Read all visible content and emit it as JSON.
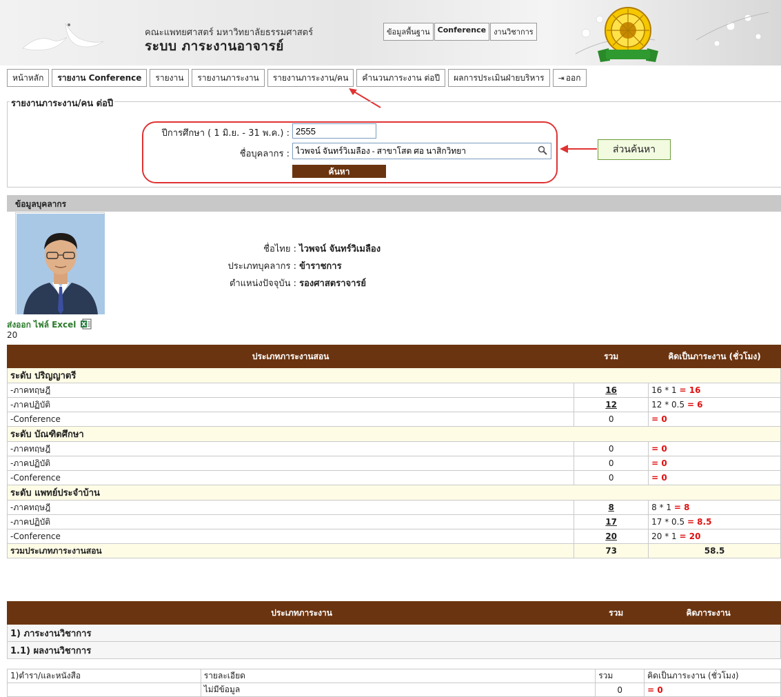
{
  "header": {
    "org_name": "คณะแพทยศาสตร์ มหาวิทยาลัยธรรมศาสตร์",
    "system_name": "ระบบ ภาระงานอาจารย์",
    "top_links": [
      "ข้อมูลพื้นฐาน",
      "Conference",
      "งานวิชาการ"
    ]
  },
  "menu": {
    "items": [
      "หน้าหลัก",
      "รายงาน Conference",
      "รายงาน",
      "รายงานภาระงาน",
      "รายงานภาระงาน/คน",
      "คำนวนภาระงาน ต่อปี",
      "ผลการประเมินฝ่ายบริหาร",
      "ออก"
    ]
  },
  "search": {
    "legend": "รายงานภาระงาน/คน ต่อปี",
    "year_label": "ปีการศึกษา ( 1 มิ.ย. - 31 พ.ค.) :",
    "year_value": "2555",
    "name_label": "ชื่อบุคลากร :",
    "name_value": "ไวพจน์ จันทร์วิเมลือง - สาขาโสต ศอ นาสิกวิทยา",
    "button": "ค้นหา",
    "callout": "ส่วนค้นหา"
  },
  "personnel": {
    "section_title": "ข้อมูลบุคลากร",
    "name_label": "ชื่อไทย :",
    "name": "ไวพจน์ จันทร์วิเมลือง",
    "type_label": "ประเภทบุคลากร :",
    "type": "ข้าราชการ",
    "position_label": "ตำแหน่งปัจจุบัน :",
    "position": "รองศาสตราจารย์"
  },
  "export_label": "ส่งออก ไฟล์ Excel",
  "count": "20",
  "teaching_table": {
    "headers": [
      "ประเภทภาระงานสอน",
      "รวม",
      "คิดเป็นภาระงาน (ชั่วโมง)"
    ],
    "groups": [
      {
        "title": "ระดับ ปริญญาตรี",
        "rows": [
          {
            "label": "-ภาคทฤษฎี",
            "total": "16",
            "calc": "16 * 1",
            "result": "= 16"
          },
          {
            "label": "-ภาคปฏิบัติ",
            "total": "12",
            "calc": "12 * 0.5",
            "result": "= 6"
          },
          {
            "label": "-Conference",
            "total": "0",
            "calc": "",
            "result": "= 0"
          }
        ]
      },
      {
        "title": "ระดับ บัณฑิตศึกษา",
        "rows": [
          {
            "label": "-ภาคทฤษฎี",
            "total": "0",
            "calc": "",
            "result": "= 0"
          },
          {
            "label": "-ภาคปฏิบัติ",
            "total": "0",
            "calc": "",
            "result": "= 0"
          },
          {
            "label": "-Conference",
            "total": "0",
            "calc": "",
            "result": "= 0"
          }
        ]
      },
      {
        "title": "ระดับ แพทย์ประจำบ้าน",
        "rows": [
          {
            "label": "-ภาคทฤษฎี",
            "total": "8",
            "calc": "8 * 1",
            "result": "= 8"
          },
          {
            "label": "-ภาคปฏิบัติ",
            "total": "17",
            "calc": "17 * 0.5",
            "result": "= 8.5"
          },
          {
            "label": "-Conference",
            "total": "20",
            "calc": "20 * 1",
            "result": "= 20"
          }
        ]
      }
    ],
    "summary": {
      "label": "รวมประเภทภาระงานสอน",
      "total": "73",
      "hours": "58.5"
    }
  },
  "workload_table": {
    "headers": [
      "ประเภทภาระงาน",
      "รวม",
      "คิดภาระงาน"
    ],
    "section1": "1) ภาระงานวิชาการ",
    "section11": "1.1) ผลงานวิชาการ",
    "sub_headers": [
      "1)ตำรา/และหนังสือ",
      "รายละเอียด",
      "รวม",
      "คิดเป็นภาระงาน (ชั่วโมง)"
    ],
    "row": {
      "detail": "ไม่มีข้อมูล",
      "total": "0",
      "result": "= 0"
    }
  }
}
